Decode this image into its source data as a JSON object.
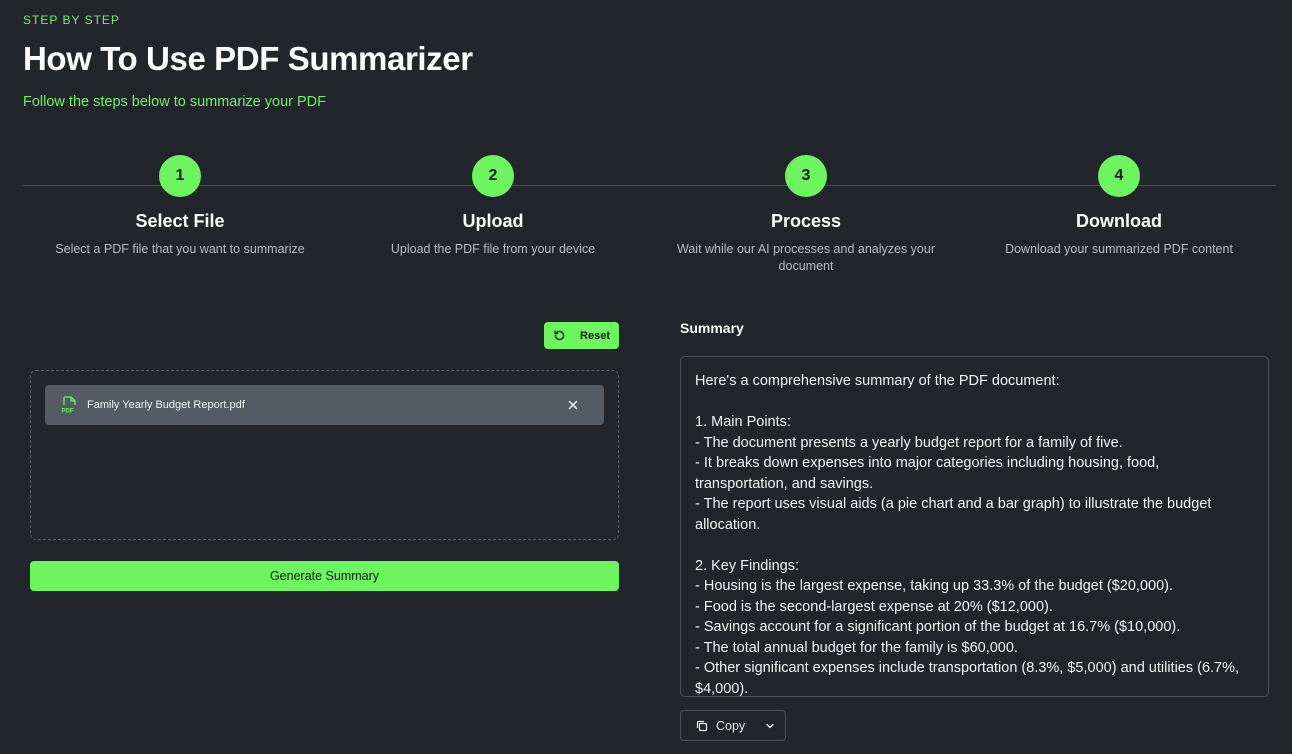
{
  "header": {
    "eyebrow": "STEP BY STEP",
    "title": "How To Use PDF Summarizer",
    "subtitle": "Follow the steps below to summarize your PDF"
  },
  "steps": [
    {
      "number": "1",
      "title": "Select File",
      "description": "Select a PDF file that you want to summarize"
    },
    {
      "number": "2",
      "title": "Upload",
      "description": "Upload the PDF file from your device"
    },
    {
      "number": "3",
      "title": "Process",
      "description": "Wait while our AI processes and analyzes your document"
    },
    {
      "number": "4",
      "title": "Download",
      "description": "Download your summarized PDF content"
    }
  ],
  "uploader": {
    "reset_label": "Reset",
    "file_name": "Family Yearly Budget Report.pdf",
    "file_icon": "pdf-icon",
    "generate_label": "Generate Summary"
  },
  "summary": {
    "label": "Summary",
    "text": "Here's a comprehensive summary of the PDF document:\n\n1. Main Points:\n- The document presents a yearly budget report for a family of five.\n- It breaks down expenses into major categories including housing, food, transportation, and savings.\n- The report uses visual aids (a pie chart and a bar graph) to illustrate the budget allocation.\n\n2. Key Findings:\n- Housing is the largest expense, taking up 33.3% of the budget ($20,000).\n- Food is the second-largest expense at 20% ($12,000).\n- Savings account for a significant portion of the budget at 16.7% ($10,000).\n- The total annual budget for the family is $60,000.\n- Other significant expenses include transportation (8.3%, $5,000) and utilities (6.7%, $4,000).",
    "copy_label": "Copy"
  },
  "colors": {
    "background": "#22252b",
    "accent": "#6cf55f",
    "chip": "#555b65"
  }
}
